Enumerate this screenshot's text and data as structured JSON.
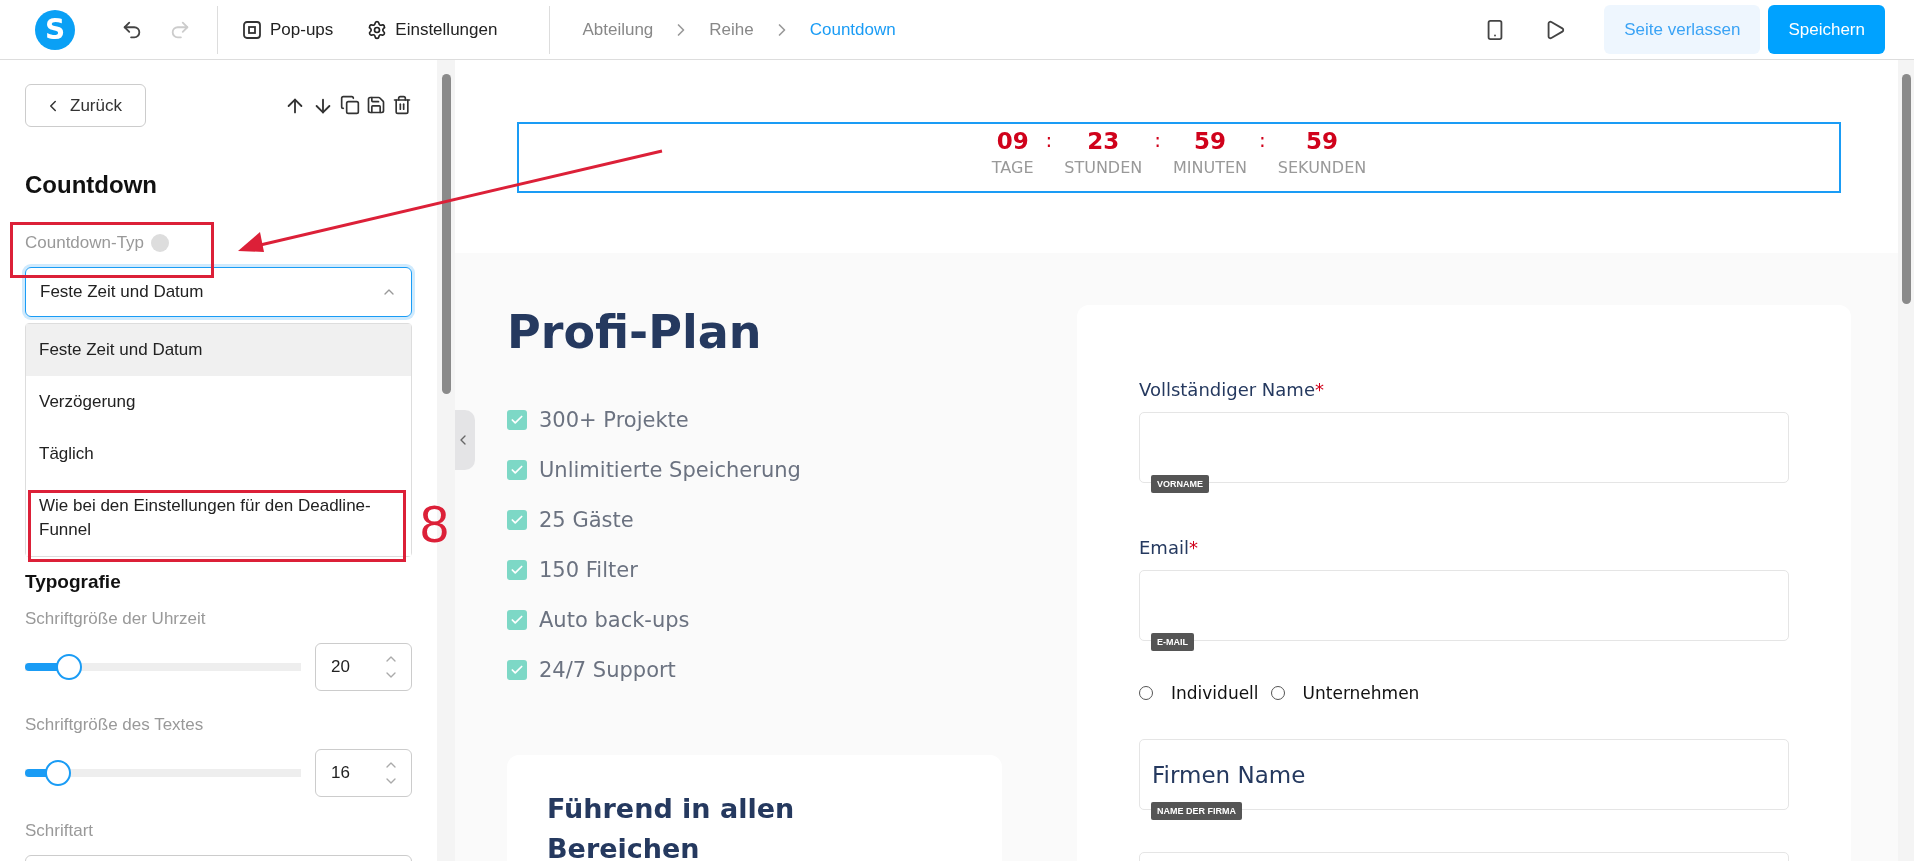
{
  "topbar": {
    "logo": "S",
    "undo": {
      "disabled": false
    },
    "redo": {
      "disabled": true
    },
    "menu": [
      {
        "kind": "popups",
        "label": "Pop-ups"
      },
      {
        "kind": "settings",
        "label": "Einstellungen"
      }
    ],
    "breadcrumb": [
      {
        "label": "Abteilung",
        "selected": false
      },
      {
        "label": "Reihe",
        "selected": false
      },
      {
        "label": "Countdown",
        "selected": true
      }
    ],
    "actions": [
      {
        "kind": "secondary",
        "label": "Seite verlassen"
      },
      {
        "kind": "primary",
        "label": "Speichern"
      }
    ]
  },
  "panel": {
    "back": "Zurück",
    "title": "Countdown",
    "type_label": "Countdown-Typ",
    "select": {
      "value": "Feste Zeit und Datum",
      "expanded": true
    },
    "options": [
      {
        "label": "Feste Zeit und Datum",
        "selected": true
      },
      {
        "label": "Verzögerung",
        "selected": false
      },
      {
        "label": "Täglich",
        "selected": false
      },
      {
        "label": "Wie bei den Einstellungen für den Deadline-Funnel",
        "selected": false
      }
    ],
    "section": "Typografie",
    "sliders": [
      {
        "label": "Schriftgröße der Uhrzeit",
        "level": 0.16,
        "value": "20"
      },
      {
        "label": "Schriftgröße des Textes",
        "level": 0.12,
        "value": "16"
      }
    ],
    "font_label": "Schriftart"
  },
  "countdown": {
    "units": [
      {
        "value": "09",
        "label": "TAGE",
        "separator": ":"
      },
      {
        "value": "23",
        "label": "STUNDEN",
        "separator": ":"
      },
      {
        "value": "59",
        "label": "MINUTEN",
        "separator": ":"
      },
      {
        "value": "59",
        "label": "SEKUNDEN"
      }
    ]
  },
  "plan": {
    "title": "Profi-Plan",
    "features": [
      {
        "label": "300+ Projekte",
        "checked": true
      },
      {
        "label": "Unlimitierte Speicherung",
        "checked": true
      },
      {
        "label": "25 Gäste",
        "checked": true
      },
      {
        "label": "150 Filter",
        "checked": true
      },
      {
        "label": "Auto back-ups",
        "checked": true
      },
      {
        "label": "24/7 Support",
        "checked": true
      }
    ],
    "card_title": "Führend in allen Bereichen"
  },
  "form": {
    "fields": [
      {
        "label": "Vollständiger Name",
        "required_mark": "*",
        "tag": "VORNAME"
      },
      {
        "label": "Email",
        "required_mark": "*",
        "tag": "E-MAIL"
      }
    ],
    "radios": [
      {
        "label": "Individuell",
        "selected": false
      },
      {
        "label": "Unternehmen",
        "selected": false
      }
    ],
    "company": {
      "placeholder": "Firmen Name",
      "tag": "NAME DER FIRMA"
    }
  },
  "annotation": {
    "step": "8"
  }
}
